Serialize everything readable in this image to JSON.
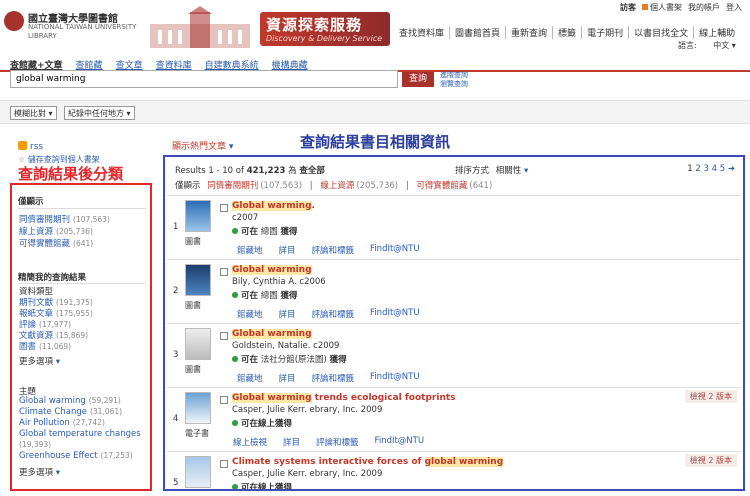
{
  "header": {
    "logo_zh": "國立臺灣大學圖書館",
    "logo_en1": "NATIONAL TAIWAN UNIVERSITY",
    "logo_en2": "LIBRARY",
    "banner_zh": "資源探索服務",
    "banner_en": "Discovery & Delivery Service",
    "top_links": [
      "訪客",
      "個人書架",
      "我的帳戶",
      "登入"
    ],
    "nav": [
      "查找資料庫",
      "圖書館首頁",
      "重新查詢",
      "標籤",
      "電子期刊",
      "以書目找全文",
      "線上輔助"
    ],
    "lang_label": "語言:",
    "lang_value": "中文"
  },
  "tabs": [
    "查館藏+文章",
    "查館藏",
    "查文章",
    "查資料庫",
    "自建數典系統",
    "機構典藏"
  ],
  "search": {
    "value": "global warming",
    "button": "查詢",
    "adv1": "進階查詢",
    "adv2": "瀏覽查詢"
  },
  "filters": {
    "match": "模糊比對",
    "scope": "紀錄中任何地方"
  },
  "sidebar": {
    "rss": "rss",
    "save_query": "儲存查詢到個人書架",
    "annotation": "查詢結果後分類",
    "show_only_title": "僅顯示",
    "show_only": [
      {
        "label": "同儕審閱期刊",
        "count": "(107,563)"
      },
      {
        "label": "線上資源",
        "count": "(205,736)"
      },
      {
        "label": "可得實體館藏",
        "count": "(641)"
      }
    ],
    "refine_title": "精簡我的查詢結果",
    "type_title": "資料類型",
    "types": [
      {
        "label": "期刊文獻",
        "count": "(191,375)"
      },
      {
        "label": "報紙文章",
        "count": "(175,955)"
      },
      {
        "label": "評論",
        "count": "(17,977)"
      },
      {
        "label": "文獻資源",
        "count": "(15,869)"
      },
      {
        "label": "圖書",
        "count": "(11,069)"
      }
    ],
    "more": "更多選項",
    "topic_title": "主題",
    "topics": [
      {
        "label": "Global warming",
        "count": "(59,291)"
      },
      {
        "label": "Climate Change",
        "count": "(31,061)"
      },
      {
        "label": "Air Pollution",
        "count": "(27,742)"
      },
      {
        "label": "Global temperature changes",
        "count": "(19,393)"
      },
      {
        "label": "Greenhouse Effect",
        "count": "(17,253)"
      }
    ]
  },
  "results": {
    "hot_label": "顯示熱門文章",
    "annotation": "查詢結果書目相關資訊",
    "summary_prefix": "Results 1 - 10 of",
    "total": "421,223",
    "summary_suffix": "為",
    "scope": "查全部",
    "sort_label": "排序方式",
    "sort_value": "相關性",
    "pages": [
      "1",
      "2",
      "3",
      "4",
      "5"
    ],
    "show_label": "僅顯示",
    "show": [
      {
        "label": "同儕審閱期刊",
        "count": "(107,563)"
      },
      {
        "label": "線上資源",
        "count": "(205,736)"
      },
      {
        "label": "可得實體館藏",
        "count": "(641)"
      }
    ],
    "records": [
      {
        "num": "1",
        "type": "圖書",
        "title_hl": "Global warming",
        "title_rest": ".",
        "author": "c2007",
        "avail_status": "可在",
        "avail_loc": "總圖",
        "avail_end": "獲得",
        "actions": [
          "館藏地",
          "詳目",
          "評論和標籤",
          "FindIt@NTU"
        ],
        "versions": ""
      },
      {
        "num": "2",
        "type": "圖書",
        "title_hl": "Global warming",
        "title_rest": "",
        "author": "Bily, Cynthia A. c2006",
        "avail_status": "可在",
        "avail_loc": "總圖",
        "avail_end": "獲得",
        "actions": [
          "館藏地",
          "詳目",
          "評論和標籤",
          "FindIt@NTU"
        ],
        "versions": ""
      },
      {
        "num": "3",
        "type": "圖書",
        "title_hl": "Global warming",
        "title_rest": "",
        "author": "Goldstein, Natalie. c2009",
        "avail_status": "可在",
        "avail_loc": "法社分館(原法圖)",
        "avail_end": "獲得",
        "actions": [
          "館藏地",
          "詳目",
          "評論和標籤",
          "FindIt@NTU"
        ],
        "versions": ""
      },
      {
        "num": "4",
        "type": "電子書",
        "title_hl": "Global warming",
        "title_rest": " trends ecological footprints",
        "author": "Casper, Julie Kerr. ebrary, Inc. 2009",
        "avail_status": "可在線上獲得",
        "avail_loc": "",
        "avail_end": "",
        "actions": [
          "線上檢視",
          "詳目",
          "評論和標籤",
          "FindIt@NTU"
        ],
        "versions": "檢視 2 版本"
      },
      {
        "num": "5",
        "type": "電子書",
        "title_hl": "global warming",
        "title_pre": "Climate systems interactive forces of ",
        "title_rest": "",
        "author": "Casper, Julie Kerr. ebrary, Inc. 2009",
        "avail_status": "可在線上獲得",
        "avail_loc": "",
        "avail_end": "",
        "actions": [],
        "versions": "檢視 2 版本"
      }
    ]
  },
  "colors": {
    "brand_red": "#a7312d",
    "annotation_red": "#e0282e",
    "annotation_blue": "#3b4db8",
    "link": "#2a5db0"
  }
}
